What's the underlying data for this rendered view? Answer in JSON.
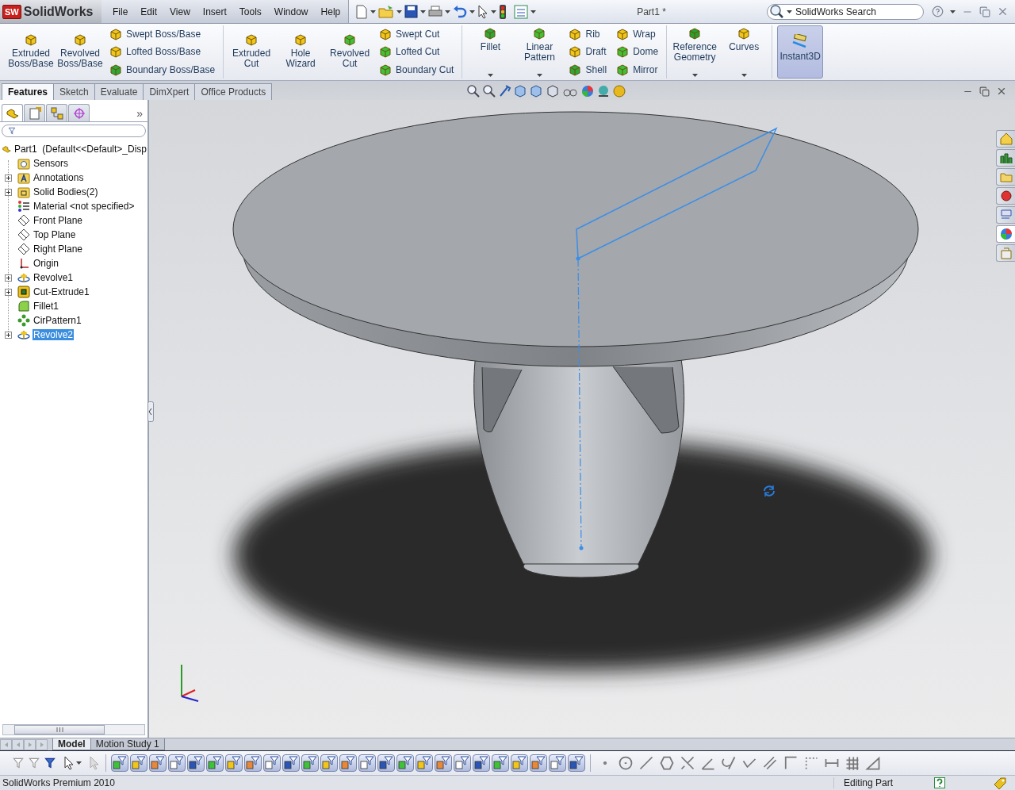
{
  "title_bar": {
    "logo_badge": "SW",
    "logo": "SolidWorks",
    "menu": [
      "File",
      "Edit",
      "View",
      "Insert",
      "Tools",
      "Window",
      "Help"
    ],
    "document": "Part1 *",
    "search": {
      "placeholder": "SolidWorks Search"
    }
  },
  "ribbon": {
    "groups": [
      {
        "columns": [
          {
            "kind": "large",
            "label": "Extruded Boss/Base",
            "menu": false
          },
          {
            "kind": "large",
            "label": "Revolved Boss/Base",
            "menu": false
          },
          {
            "kind": "stack",
            "items": [
              "Swept Boss/Base",
              "Lofted Boss/Base",
              "Boundary Boss/Base"
            ]
          }
        ]
      },
      {
        "columns": [
          {
            "kind": "large",
            "label": "Extruded Cut",
            "menu": false
          },
          {
            "kind": "large",
            "label": "Hole Wizard",
            "menu": false
          },
          {
            "kind": "large",
            "label": "Revolved Cut",
            "menu": false
          },
          {
            "kind": "stack",
            "items": [
              "Swept Cut",
              "Lofted Cut",
              "Boundary Cut"
            ]
          }
        ]
      },
      {
        "columns": [
          {
            "kind": "large",
            "label": "Fillet",
            "menu": true
          },
          {
            "kind": "large",
            "label": "Linear Pattern",
            "menu": true
          },
          {
            "kind": "stack",
            "items": [
              "Rib",
              "Draft",
              "Shell"
            ]
          },
          {
            "kind": "stack",
            "items": [
              "Wrap",
              "Dome",
              "Mirror"
            ]
          }
        ]
      },
      {
        "columns": [
          {
            "kind": "large",
            "label": "Reference Geometry",
            "menu": true
          },
          {
            "kind": "large",
            "label": "Curves",
            "menu": true
          }
        ]
      }
    ],
    "instant3d": {
      "label": "Instant3D",
      "on": true
    }
  },
  "command_tabs": [
    {
      "label": "Features",
      "selected": true
    },
    {
      "label": "Sketch",
      "selected": false
    },
    {
      "label": "Evaluate",
      "selected": false
    },
    {
      "label": "DimXpert",
      "selected": false
    },
    {
      "label": "Office Products",
      "selected": false
    }
  ],
  "feature_tree": {
    "tabs": [
      {
        "selected": true
      },
      {
        "selected": false
      },
      {
        "selected": false
      },
      {
        "selected": false
      }
    ],
    "more": "»",
    "root": {
      "kind": "part",
      "label": "Part1  (Default<<Default>_Disp",
      "selected": false,
      "children": [
        {
          "kind": "sensors",
          "label": "Sensors",
          "selected": false
        },
        {
          "kind": "annotations",
          "label": "Annotations",
          "expanded": false,
          "selected": false
        },
        {
          "kind": "bodies",
          "label": "Solid Bodies(2)",
          "expanded": false,
          "selected": false
        },
        {
          "kind": "material",
          "label": "Material <not specified>",
          "selected": false
        },
        {
          "kind": "plane",
          "label": "Front Plane",
          "selected": false
        },
        {
          "kind": "plane",
          "label": "Top Plane",
          "selected": false
        },
        {
          "kind": "plane",
          "label": "Right Plane",
          "selected": false
        },
        {
          "kind": "origin",
          "label": "Origin",
          "selected": false
        },
        {
          "kind": "revolve",
          "label": "Revolve1",
          "expanded": false,
          "selected": false
        },
        {
          "kind": "extrude",
          "label": "Cut-Extrude1",
          "expanded": false,
          "selected": false
        },
        {
          "kind": "fillet",
          "label": "Fillet1",
          "selected": false
        },
        {
          "kind": "pattern",
          "label": "CirPattern1",
          "selected": false
        },
        {
          "kind": "revolve",
          "label": "Revolve2",
          "expanded": false,
          "selected": true
        }
      ]
    }
  },
  "task_pane": [
    {
      "selected": false
    },
    {
      "selected": false
    },
    {
      "selected": false
    },
    {
      "selected": false
    },
    {
      "selected": false
    },
    {
      "selected": true
    },
    {
      "selected": false
    }
  ],
  "bottom_tabs": [
    {
      "label": "Model",
      "selected": true
    },
    {
      "label": "Motion Study 1",
      "selected": false
    }
  ],
  "status_bar": {
    "product": "SolidWorks Premium 2010",
    "mode": "Editing Part"
  }
}
